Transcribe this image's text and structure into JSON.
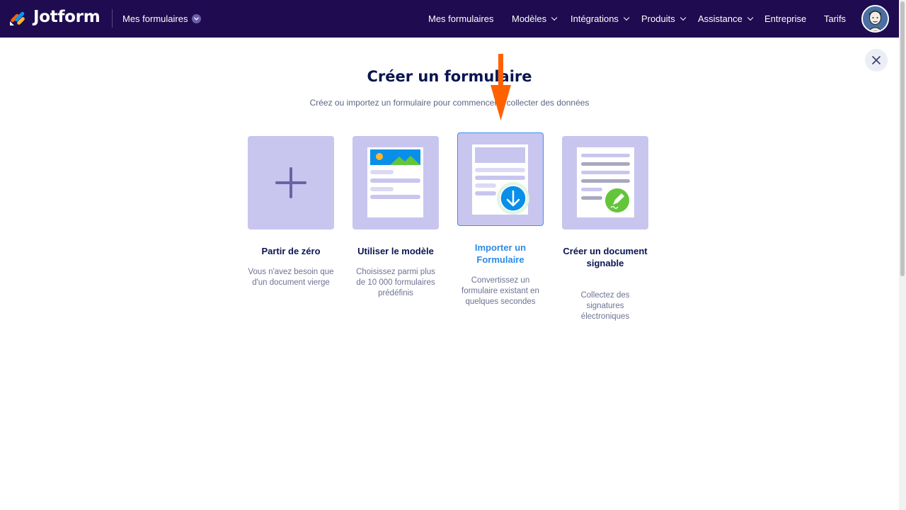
{
  "app": {
    "brand": "Jotform",
    "workspace_label": "Mes formulaires"
  },
  "nav": {
    "items": [
      {
        "label": "Mes formulaires",
        "dropdown": false
      },
      {
        "label": "Modèles",
        "dropdown": true
      },
      {
        "label": "Intégrations",
        "dropdown": true
      },
      {
        "label": "Produits",
        "dropdown": true
      },
      {
        "label": "Assistance",
        "dropdown": true
      },
      {
        "label": "Entreprise",
        "dropdown": false
      },
      {
        "label": "Tarifs",
        "dropdown": false
      }
    ]
  },
  "modal": {
    "title": "Créer un formulaire",
    "subtitle": "Créez ou importez un formulaire pour commencer à collecter des données",
    "options": [
      {
        "title": "Partir de zéro",
        "description": "Vous n'avez besoin que d'un document vierge",
        "icon": "plus-icon"
      },
      {
        "title": "Utiliser le modèle",
        "description": "Choisissez parmi plus de 10 000 formulaires prédéfinis",
        "icon": "template-icon"
      },
      {
        "title": "Importer un Formulaire",
        "description": "Convertissez un formulaire existant en quelques secondes",
        "icon": "import-icon",
        "selected": true
      },
      {
        "title": "Créer un document signable",
        "description": "Collectez des signatures électroniques",
        "icon": "sign-document-icon"
      }
    ]
  },
  "colors": {
    "topbar": "#1f0b4f",
    "card": "#c8c6ef",
    "accent": "#2d8ae6",
    "arrow": "#ff6100"
  }
}
